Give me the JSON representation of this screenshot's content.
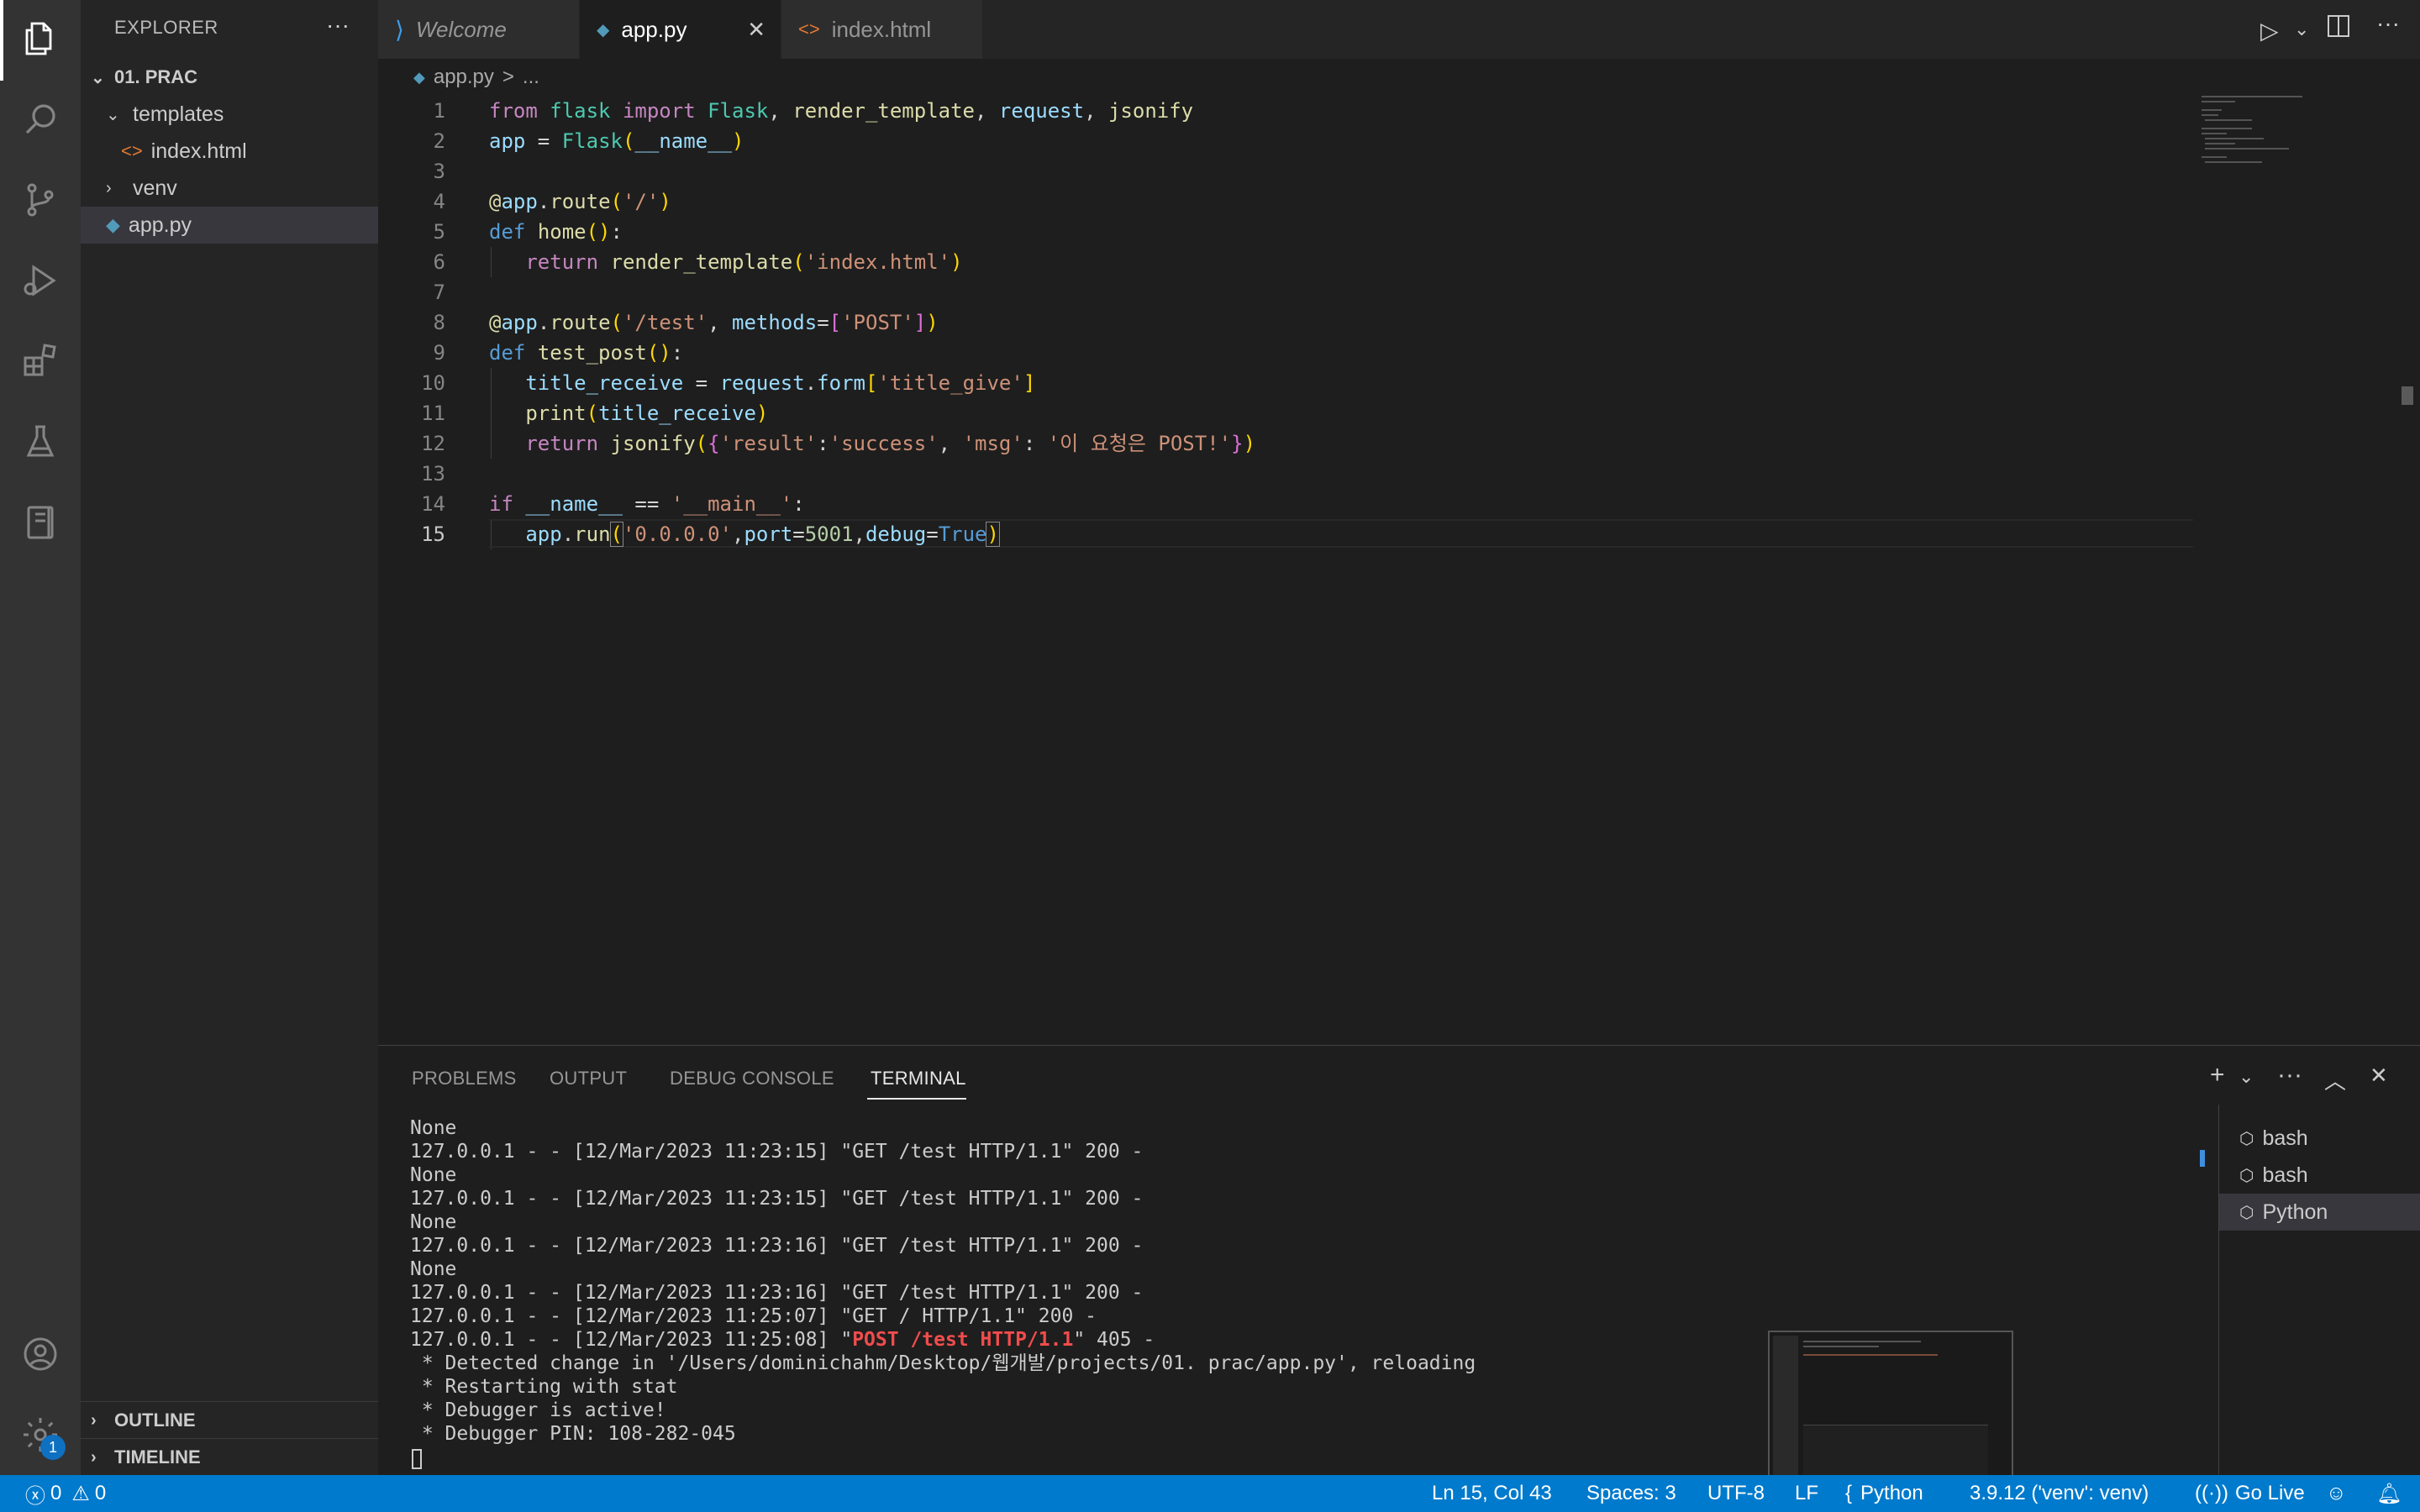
{
  "explorer": {
    "title": "EXPLORER",
    "more": "···",
    "folder": "01. PRAC",
    "tree": [
      {
        "label": "templates",
        "type": "folder",
        "expanded": true
      },
      {
        "label": "index.html",
        "type": "html"
      },
      {
        "label": "venv",
        "type": "folder",
        "expanded": false
      },
      {
        "label": "app.py",
        "type": "python"
      }
    ],
    "outline": "OUTLINE",
    "timeline": "TIMELINE"
  },
  "tabs": [
    {
      "label": "Welcome",
      "icon": "vscode-icon"
    },
    {
      "label": "app.py",
      "icon": "python-icon",
      "close": "✕"
    },
    {
      "label": "index.html",
      "icon": "html-icon"
    }
  ],
  "breadcrumb": {
    "file": "app.py",
    "sep": ">",
    "rest": "..."
  },
  "editor": {
    "line_numbers": [
      "1",
      "2",
      "3",
      "4",
      "5",
      "6",
      "7",
      "8",
      "9",
      "10",
      "11",
      "12",
      "13",
      "14",
      "15"
    ],
    "current_line": 15
  },
  "panel": {
    "tabs": [
      "PROBLEMS",
      "OUTPUT",
      "DEBUG CONSOLE",
      "TERMINAL"
    ],
    "active_tab": "TERMINAL",
    "terminal_lines": [
      "None",
      "127.0.0.1 - - [12/Mar/2023 11:23:15] \"GET /test HTTP/1.1\" 200 -",
      "None",
      "127.0.0.1 - - [12/Mar/2023 11:23:15] \"GET /test HTTP/1.1\" 200 -",
      "None",
      "127.0.0.1 - - [12/Mar/2023 11:23:16] \"GET /test HTTP/1.1\" 200 -",
      "None",
      "127.0.0.1 - - [12/Mar/2023 11:23:16] \"GET /test HTTP/1.1\" 200 -",
      "127.0.0.1 - - [12/Mar/2023 11:25:07] \"GET / HTTP/1.1\" 200 -"
    ],
    "post_line": {
      "prefix": "127.0.0.1 - - [12/Mar/2023 11:25:08] \"",
      "red": "POST /test HTTP/1.1",
      "suffix": "\" 405 -"
    },
    "tail_lines": [
      " * Detected change in '/Users/dominichahm/Desktop/웹개발/projects/01. prac/app.py', reloading",
      " * Restarting with stat",
      " * Debugger is active!",
      " * Debugger PIN: 108-282-045"
    ],
    "terminals": [
      "bash",
      "bash",
      "Python"
    ]
  },
  "status": {
    "errors": "0",
    "warnings": "0",
    "position": "Ln 15, Col 43",
    "spaces": "Spaces: 3",
    "encoding": "UTF-8",
    "eol": "LF",
    "language": "Python",
    "interpreter": "3.9.12 ('venv': venv)",
    "golive": "Go Live",
    "settings_badge": "1"
  }
}
